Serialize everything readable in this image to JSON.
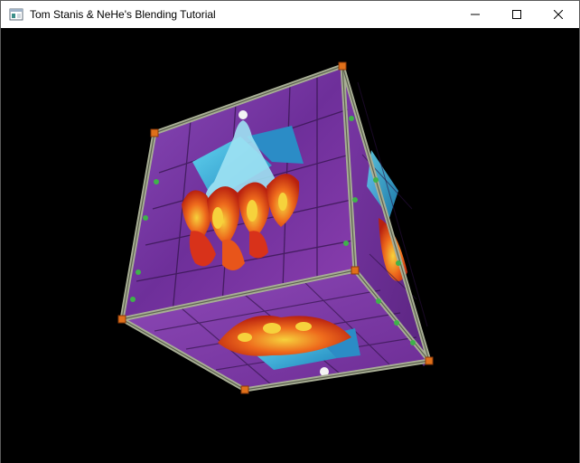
{
  "window": {
    "title": "Tom Stanis & NeHe's Blending Tutorial",
    "app_icon": "opengl-window-icon",
    "controls": {
      "minimize_icon": "minimize-icon",
      "maximize_icon": "maximize-icon",
      "close_icon": "close-icon"
    }
  },
  "scene": {
    "background_color": "#000000",
    "object": "stained-glass-textured-cube",
    "colors": {
      "glass_purple": "#7a3aa8",
      "glass_blue": "#2aa4d0",
      "flame_red": "#d8321a",
      "flame_yellow": "#f2c431",
      "lead_frame": "#9aa08a",
      "corner_orange": "#e0701a"
    }
  }
}
